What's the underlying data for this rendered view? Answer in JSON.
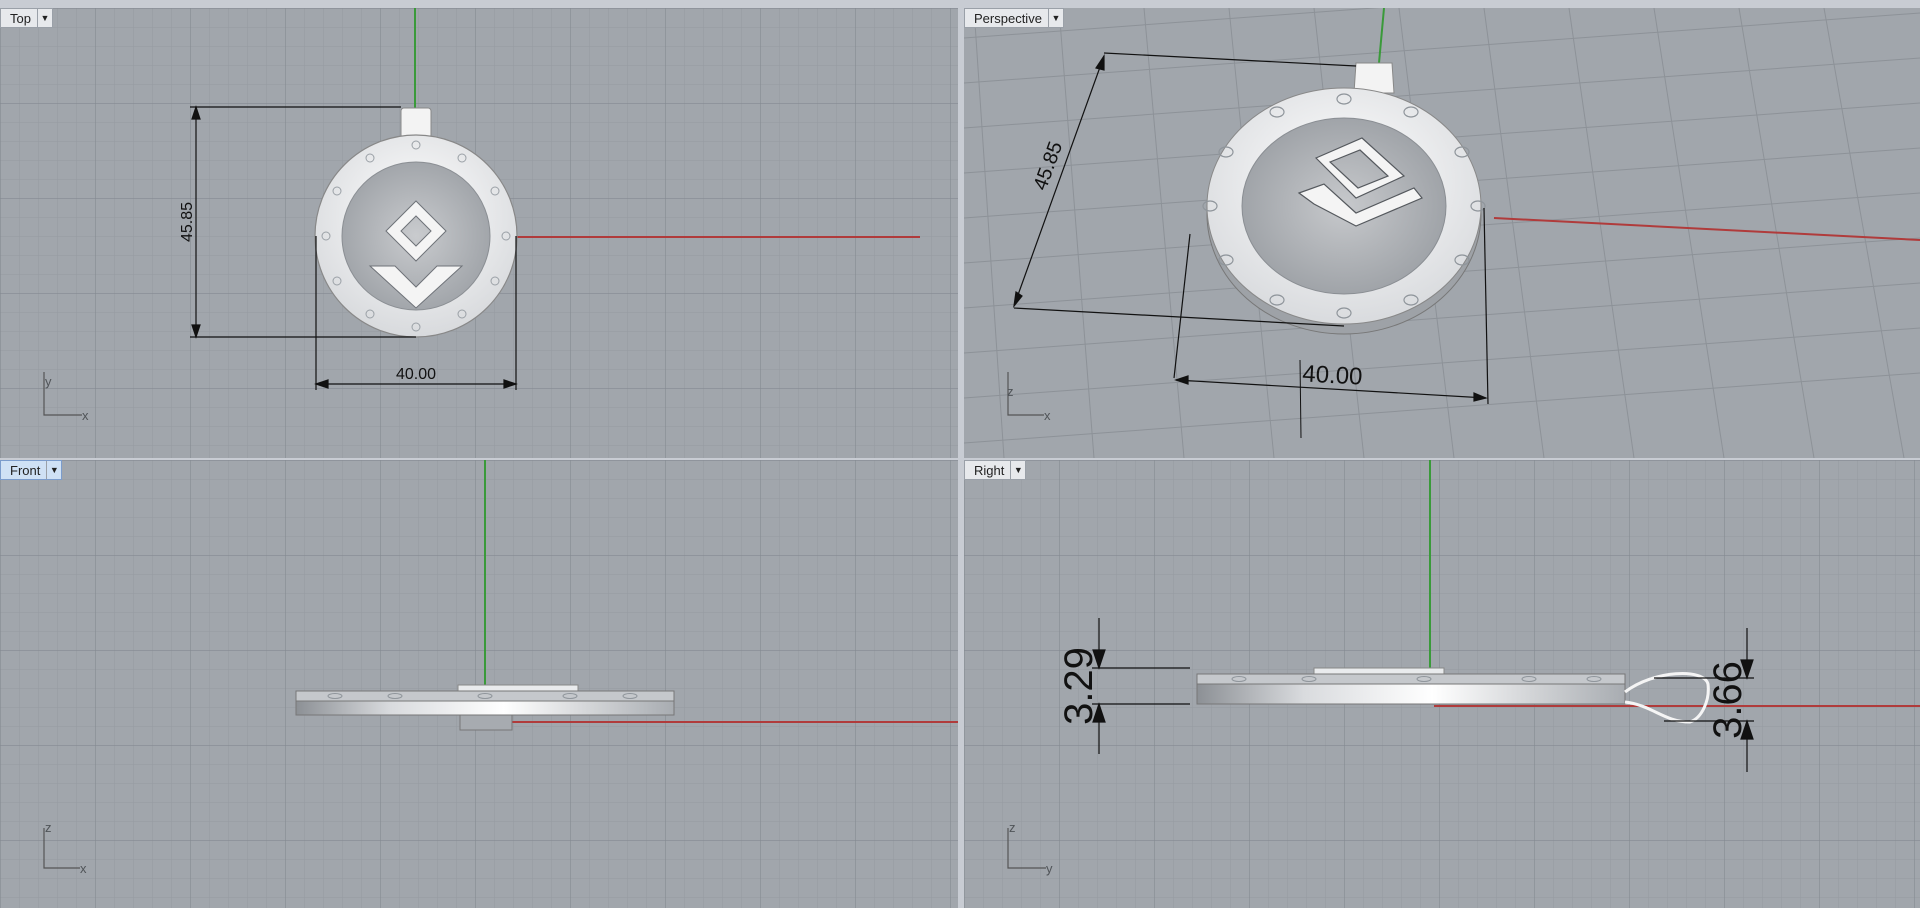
{
  "viewports": {
    "top": {
      "name": "Top",
      "dim_height": "45.85",
      "dim_width": "40.00",
      "axis_v": "y",
      "axis_h": "x"
    },
    "perspective": {
      "name": "Perspective",
      "dim_height": "45.85",
      "dim_width": "40.00",
      "axis_v": "z",
      "axis_h": "x"
    },
    "front": {
      "name": "Front",
      "axis_v": "z",
      "axis_h": "x"
    },
    "right": {
      "name": "Right",
      "dim_left": "3.29",
      "dim_right": "3.66",
      "axis_v": "z",
      "axis_h": "y"
    }
  },
  "colors": {
    "viewport_bg": "#a1a6ac",
    "grid_minor": "#949aa1",
    "grid_major": "#858b92",
    "x_axis": "#b03b3b",
    "y_axis": "#3a9a3a",
    "active_label": "#cfe1f5"
  },
  "icons": {
    "dropdown": "dropdown-arrow-icon"
  }
}
